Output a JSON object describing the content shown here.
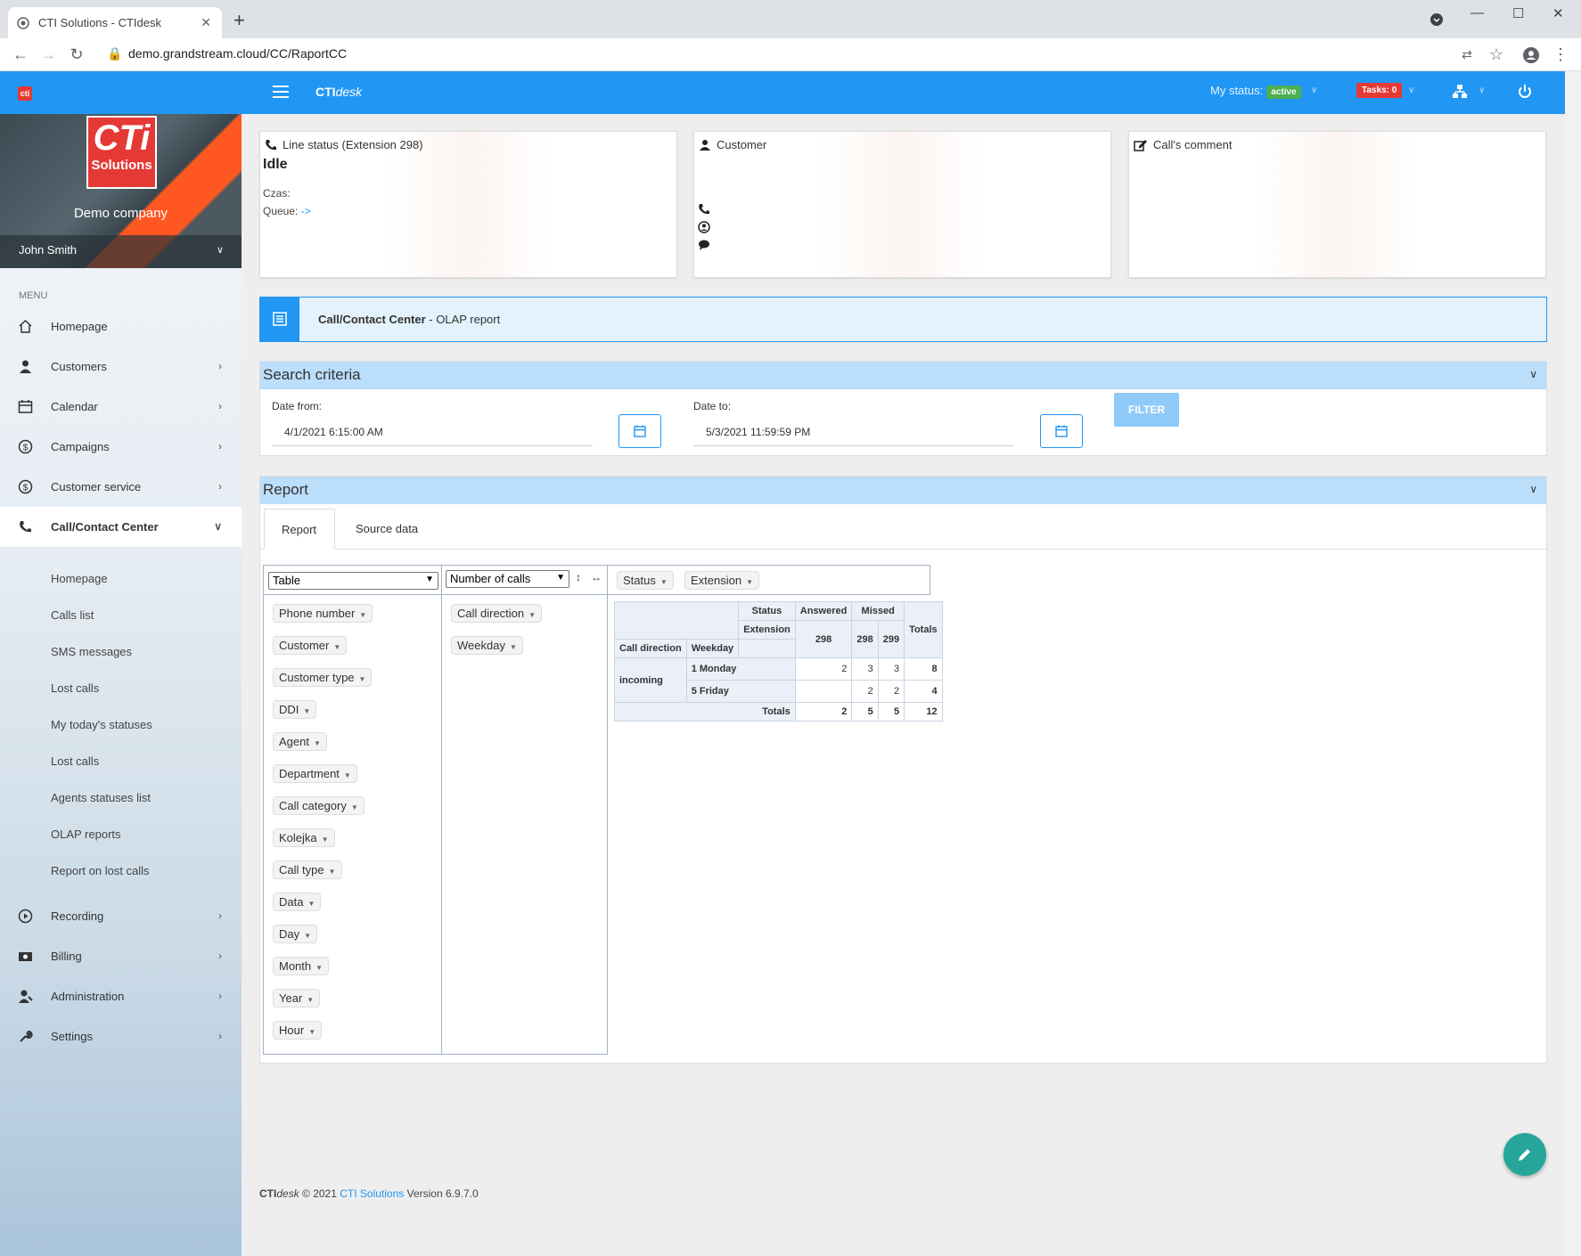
{
  "browser": {
    "tab_title": "CTI Solutions - CTIdesk",
    "url": "demo.grandstream.cloud/CC/RaportCC"
  },
  "topbar": {
    "brand_bold": "CTI",
    "brand_italic": "desk",
    "my_status_label": "My status:",
    "my_status_value": "active",
    "tasks": "Tasks: 0"
  },
  "sidebar": {
    "logo_big": "CTi",
    "logo_small": "Solutions",
    "company": "Demo company",
    "user": "John Smith",
    "menu_label": "MENU",
    "items": [
      {
        "label": "Homepage",
        "icon": "home-icon"
      },
      {
        "label": "Customers",
        "icon": "customer-icon"
      },
      {
        "label": "Calendar",
        "icon": "calendar-icon"
      },
      {
        "label": "Campaigns",
        "icon": "dollar-icon"
      },
      {
        "label": "Customer service",
        "icon": "dollar-icon"
      },
      {
        "label": "Call/Contact Center",
        "icon": "phone-icon"
      }
    ],
    "subitems": [
      "Homepage",
      "Calls list",
      "SMS messages",
      "Lost calls",
      "My today's statuses",
      "Lost calls",
      "Agents statuses list",
      "OLAP reports",
      "Report on lost calls"
    ],
    "items_bottom": [
      {
        "label": "Recording",
        "icon": "play-icon"
      },
      {
        "label": "Billing",
        "icon": "money-icon"
      },
      {
        "label": "Administration",
        "icon": "admin-icon"
      },
      {
        "label": "Settings",
        "icon": "wrench-icon"
      }
    ]
  },
  "cards": {
    "line_status_title": "Line status (Extension 298)",
    "line_status_value": "Idle",
    "czas_label": "Czas:",
    "queue_label": "Queue:",
    "queue_value": "->",
    "customer_title": "Customer",
    "comment_title": "Call's comment"
  },
  "banner": {
    "title": "Call/Contact Center",
    "subtitle": " - OLAP report"
  },
  "search": {
    "title": "Search criteria",
    "date_from_label": "Date from:",
    "date_from_value": "4/1/2021 6:15:00 AM",
    "date_to_label": "Date to:",
    "date_to_value": "5/3/2021 11:59:59 PM",
    "filter_label": "FILTER"
  },
  "report": {
    "title": "Report",
    "tabs": [
      "Report",
      "Source data"
    ],
    "renderer": "Table",
    "aggregator": "Number of calls",
    "col_fields": [
      "Status",
      "Extension"
    ],
    "row_fields": [
      "Call direction",
      "Weekday"
    ],
    "unused_fields": [
      "Phone number",
      "Customer",
      "Customer type",
      "DDI",
      "Agent",
      "Department",
      "Call category",
      "Kolejka",
      "Call type",
      "Data",
      "Day",
      "Month",
      "Year",
      "Hour"
    ]
  },
  "pivot": {
    "h_status": "Status",
    "h_extension": "Extension",
    "answered": "Answered",
    "missed": "Missed",
    "totals": "Totals",
    "ext_answered": "298",
    "ext_m1": "298",
    "ext_m2": "299",
    "h_call_direction": "Call direction",
    "h_weekday": "Weekday",
    "incoming": "incoming",
    "rows": [
      {
        "label": "1 Monday",
        "a298": "2",
        "m298": "3",
        "m299": "3",
        "total": "8"
      },
      {
        "label": "5 Friday",
        "a298": "",
        "m298": "2",
        "m299": "2",
        "total": "4"
      }
    ],
    "totals_row": {
      "label": "Totals",
      "a298": "2",
      "m298": "5",
      "m299": "5",
      "total": "12"
    }
  },
  "footer": {
    "brand_bold": "CTI",
    "brand_italic": "desk",
    "copyright": " © 2021 ",
    "company_link": "CTI Solutions",
    "version": " Version 6.9.7.0"
  },
  "colors": {
    "primary": "#2196f3",
    "active": "#4caf50",
    "danger": "#e53935",
    "fab": "#26a69a"
  }
}
